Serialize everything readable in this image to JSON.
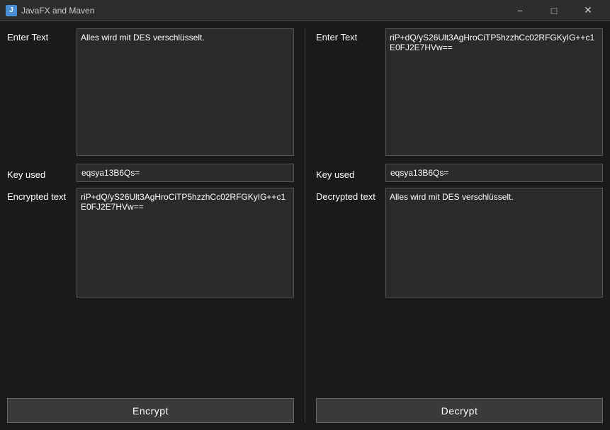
{
  "window": {
    "title": "JavaFX and Maven",
    "icon": "J",
    "controls": {
      "minimize": "−",
      "maximize": "□",
      "close": "✕"
    }
  },
  "encrypt_panel": {
    "enter_text_label": "Enter Text",
    "enter_text_value": "Alles wird mit DES verschlüsselt.",
    "key_label": "Key used",
    "key_value": "eqsya13B6Qs=",
    "encrypted_label": "Encrypted text",
    "encrypted_value": "riP+dQ/yS26Ult3AgHroCiTP5hzzhCc02RFGKyIG++c1E0FJ2E7HVw==",
    "button_label": "Encrypt"
  },
  "decrypt_panel": {
    "enter_text_label": "Enter Text",
    "enter_text_value": "riP+dQ/yS26Ult3AgHroCiTP5hzzhCc02RFGKyIG++c1E0FJ2E7HVw==",
    "key_label": "Key used",
    "key_value": "eqsya13B6Qs=",
    "decrypted_label": "Decrypted text",
    "decrypted_value": "Alles wird mit DES verschlüsselt.",
    "button_label": "Decrypt"
  }
}
